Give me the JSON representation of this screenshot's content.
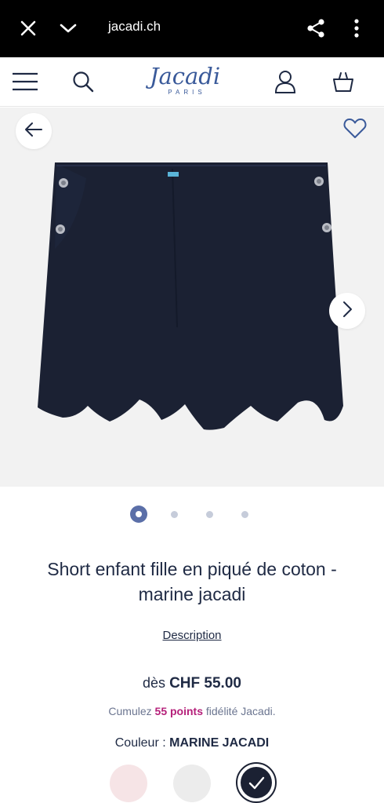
{
  "browser": {
    "domain": "jacadi.ch",
    "icons": [
      "close-icon",
      "chevron-down-icon",
      "share-icon",
      "more-vert-icon"
    ]
  },
  "header": {
    "logo_word": "Jacadi",
    "logo_sub": "PARIS",
    "icons": [
      "menu-icon",
      "search-icon",
      "account-icon",
      "basket-icon"
    ]
  },
  "gallery": {
    "slide_count": 4,
    "active_slide": 1,
    "icons": [
      "arrow-left-icon",
      "heart-icon",
      "chevron-right-icon"
    ]
  },
  "product": {
    "title_line1": "Short enfant fille en piqué de coton -",
    "title_line2": "marine jacadi",
    "description_link": "Description",
    "price_prefix": "dès",
    "price": "CHF 55.00",
    "points_prefix": "Cumulez",
    "points": "55 points",
    "points_suffix": "fidélité Jacadi.",
    "colour_label": "Couleur :",
    "colour_name": "MARINE JACADI"
  },
  "colors": {
    "browser_bar": "#000000",
    "brand_blue": "#3a5a9a",
    "text_navy": "#1f2a44",
    "points_magenta": "#b5207a",
    "product_navy": "#1b2133",
    "swatch_pink": "#f6e4e6",
    "swatch_grey": "#ececec",
    "swatch_navy": "#1b2133"
  }
}
